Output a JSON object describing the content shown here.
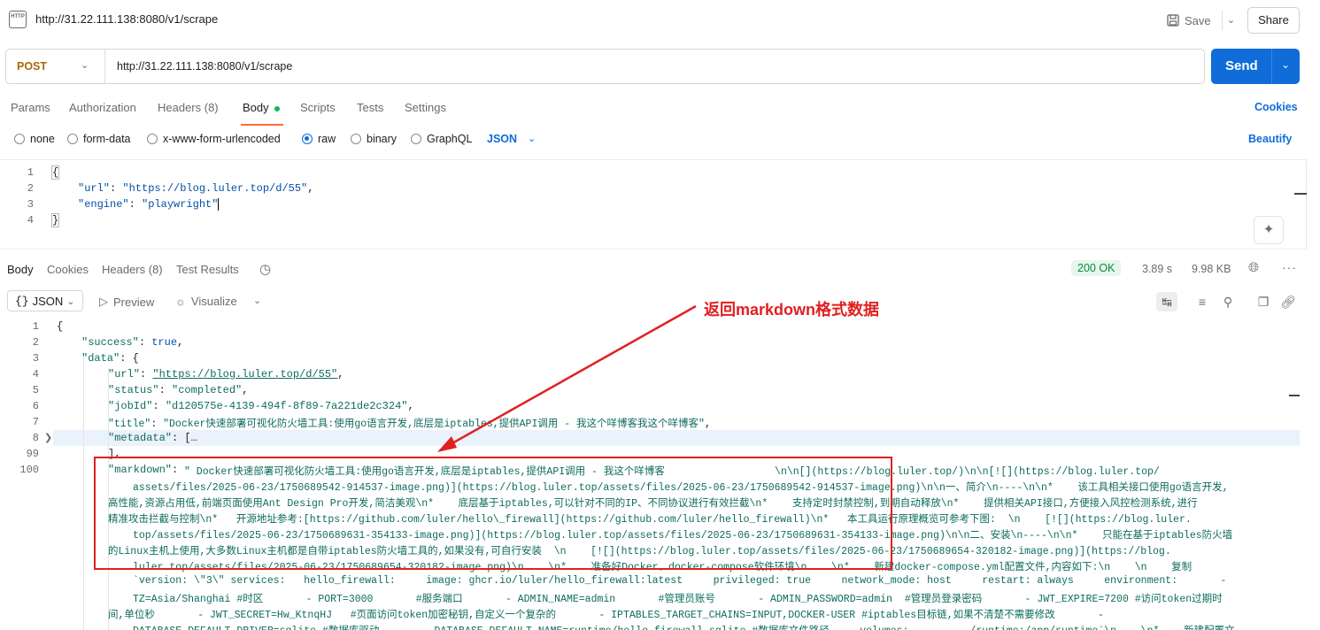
{
  "header": {
    "title": "http://31.22.111.138:8080/v1/scrape",
    "http_icon": "HTTP",
    "save_label": "Save",
    "share_label": "Share"
  },
  "request": {
    "method": "POST",
    "url": "http://31.22.111.138:8080/v1/scrape",
    "send_label": "Send",
    "tabs": [
      "Params",
      "Authorization",
      "Headers (8)",
      "Body",
      "Scripts",
      "Tests",
      "Settings"
    ],
    "cookies_label": "Cookies",
    "body_types": [
      "none",
      "form-data",
      "x-www-form-urlencoded",
      "raw",
      "binary",
      "GraphQL"
    ],
    "body_format": "JSON",
    "beautify_label": "Beautify",
    "body_lines": [
      {
        "n": "1",
        "text": "{"
      },
      {
        "n": "2",
        "key": "\"url\"",
        "val": "\"https://blog.luler.top/d/55\"",
        "tail": ","
      },
      {
        "n": "3",
        "key": "\"engine\"",
        "val": "\"playwright\"",
        "tail": ""
      },
      {
        "n": "4",
        "text": "}"
      }
    ]
  },
  "response": {
    "tabs": [
      "Body",
      "Cookies",
      "Headers (8)",
      "Test Results"
    ],
    "status": "200 OK",
    "time": "3.89 s",
    "size": "9.98 KB",
    "format": "JSON",
    "preview_label": "Preview",
    "visualize_label": "Visualize",
    "line_numbers": [
      "1",
      "2",
      "3",
      "4",
      "5",
      "6",
      "7",
      "8",
      "99",
      "100"
    ],
    "success_key": "\"success\"",
    "success_val": "true",
    "data_key": "\"data\"",
    "url_key": "\"url\"",
    "url_val": "\"https://blog.luler.top/d/55\"",
    "status_key": "\"status\"",
    "status_val": "\"completed\"",
    "jobid_key": "\"jobId\"",
    "jobid_val": "\"d120575e-4139-494f-8f89-7a221de2c324\"",
    "title_key": "\"title\"",
    "title_val": "\"Docker快速部署可视化防火墙工具:使用go语言开发,底层是iptables,提供API调用 - 我这个咩博客我这个咩博客\"",
    "metadata_key": "\"metadata\"",
    "metadata_val": "[…",
    "markdown_key": "\"markdown\"",
    "markdown_lines": [
      "\" Docker快速部署可视化防火墙工具:使用go语言开发,底层是iptables,提供API调用 - 我这个咩博客                  \\n\\n[](https://blog.luler.top/)\\n\\n[![](https://blog.luler.top/",
      "assets/files/2025-06-23/1750689542-914537-image.png)](https://blog.luler.top/assets/files/2025-06-23/1750689542-914537-image.png)\\n\\n一、简介\\n----\\n\\n*    该工具相关接口使用go语言开发,",
      "高性能,资源占用低,前端页面使用Ant Design Pro开发,简洁美观\\n*    底层基于iptables,可以针对不同的IP、不同协议进行有效拦截\\n*    支持定时封禁控制,到期自动释放\\n*    提供相关API接口,方便接入风控检测系统,进行",
      "精准攻击拦截与控制\\n*   开源地址参考:[https://github.com/luler/hello\\_firewall](https://github.com/luler/hello_firewall)\\n*   本工具运行原理概览可参考下图:  \\n    [![](https://blog.luler.",
      "top/assets/files/2025-06-23/1750689631-354133-image.png)](https://blog.luler.top/assets/files/2025-06-23/1750689631-354133-image.png)\\n\\n二、安装\\n----\\n\\n*    只能在基于iptables防火墙",
      "的Linux主机上使用,大多数Linux主机都是自带iptables防火墙工具的,如果没有,可自行安装  \\n    [![](https://blog.luler.top/assets/files/2025-06-23/1750689654-320182-image.png)](https://blog.",
      "luler.top/assets/files/2025-06-23/1750689654-320182-image.png)\\n    \\n*    准备好Docker、docker-compose软件环境\\n    \\n*    新建docker-compose.yml配置文件,内容如下:\\n    \\n    复制",
      "`version: \\\"3\\\" services:   hello_firewall:     image: ghcr.io/luler/hello_firewall:latest     privileged: true     network_mode: host     restart: always     environment:       -",
      "TZ=Asia/Shanghai #时区       - PORT=3000       #服务端口       - ADMIN_NAME=admin       #管理员账号       - ADMIN_PASSWORD=admin  #管理员登录密码       - JWT_EXPIRE=7200 #访问token过期时",
      "间,单位秒       - JWT_SECRET=Hw_KtnqHJ   #页面访问token加密秘钥,自定义一个复杂的       - IPTABLES_TARGET_CHAINS=INPUT,DOCKER-USER #iptables目标链,如果不清楚不需要修改       -",
      "DATABASE_DEFAULT_DRIVER=sqlite #数据库驱动       - DATABASE_DEFAULT_NAME=runtime/hello_firewall.sqlite #数据库文件路径     volumes:       - ./runtime:/app/runtime`\\n    \\n*    新建配置文"
    ]
  },
  "annotation": {
    "label": "返回markdown格式数据",
    "color": "#e02020"
  },
  "icons": [
    "http-icon",
    "save-icon",
    "chevron-down-icon",
    "history-icon",
    "globe-icon",
    "more-icon",
    "preview-icon",
    "visualize-icon",
    "wrap-icon",
    "filter-icon",
    "search-icon",
    "copy-icon",
    "link-icon",
    "magic-icon"
  ]
}
